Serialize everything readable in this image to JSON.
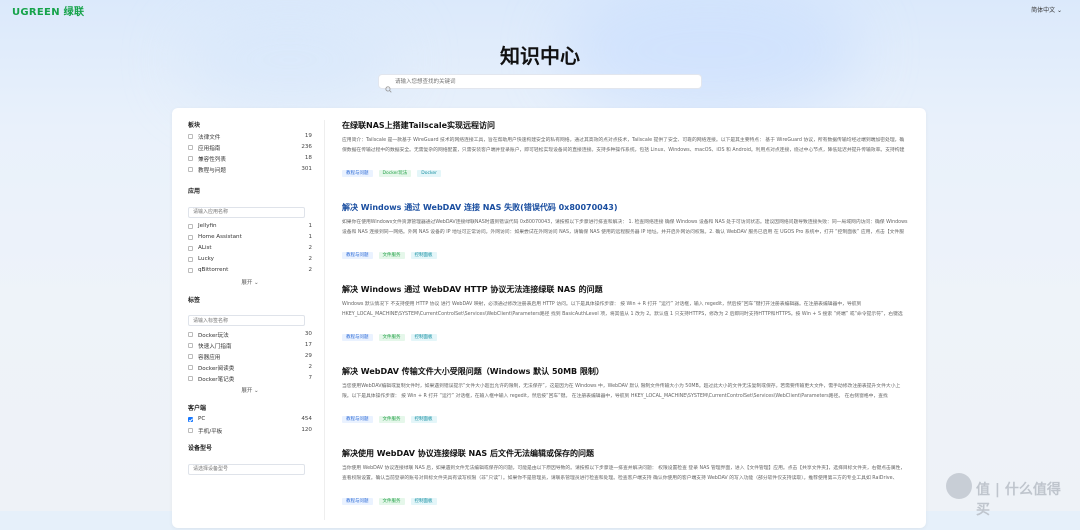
{
  "header": {
    "logo": "UGREEN 绿联",
    "language": "简体中文 ⌄"
  },
  "hero": {
    "title": "知识中心",
    "search_placeholder": "请输入您想查找的关键词"
  },
  "sidebar": {
    "sections": [
      {
        "title": "板块",
        "has_search": false,
        "items": [
          {
            "label": "法律文件",
            "count": "19",
            "checked": false
          },
          {
            "label": "应用指南",
            "count": "236",
            "checked": false
          },
          {
            "label": "兼容性列表",
            "count": "18",
            "checked": false
          },
          {
            "label": "教程与问题",
            "count": "301",
            "checked": false
          }
        ]
      },
      {
        "title": "应用",
        "has_search": true,
        "search_placeholder": "请输入应用名称",
        "items": [
          {
            "label": "Jellyfin",
            "count": "1",
            "checked": false
          },
          {
            "label": "Home Assistant",
            "count": "1",
            "checked": false
          },
          {
            "label": "AList",
            "count": "2",
            "checked": false
          },
          {
            "label": "Lucky",
            "count": "2",
            "checked": false
          },
          {
            "label": "qBittorrent",
            "count": "2",
            "checked": false
          }
        ],
        "expand": "展开 ⌄"
      },
      {
        "title": "标签",
        "has_search": true,
        "search_placeholder": "请输入标签名称",
        "items": [
          {
            "label": "Docker玩法",
            "count": "30",
            "checked": false
          },
          {
            "label": "快速入门指南",
            "count": "17",
            "checked": false
          },
          {
            "label": "容器应用",
            "count": "29",
            "checked": false
          },
          {
            "label": "Docker阅读类",
            "count": "2",
            "checked": false
          },
          {
            "label": "Docker笔记类",
            "count": "7",
            "checked": false
          }
        ],
        "expand": "展开 ⌄"
      },
      {
        "title": "客户端",
        "has_search": false,
        "items": [
          {
            "label": "PC",
            "count": "454",
            "checked": true
          },
          {
            "label": "手机/平板",
            "count": "120",
            "checked": false
          }
        ]
      },
      {
        "title": "设备型号",
        "has_search": true,
        "search_placeholder": "请选择设备型号",
        "items": []
      }
    ]
  },
  "articles": [
    {
      "title": "在绿联NAS上搭建Tailscale实现远程访问",
      "title_color": "dark",
      "excerpt": "应用简介：Tailscale 是一款基于 WireGuard 技术的网络连接工具，旨在帮助用户快速构建安全的私有网络。通过其高效的点对点技术，Tailscale 提供了安全、可靠的网络连接。以下是其主要特点： 基于 WireGuard 协议，所有数据传输均经过端到端加密处理，确保数据在传输过程中的数据安全。无需复杂的网络配置，只需安装客户端并登录账户，即可轻松实现设备间的直接连接。支持多种操作系统，包括 Linux、Windows、macOS、iOS 和 Android。利用点对点连接，绕过中心节点，降低延迟并提升传输效率。支持构建私有云服务，例如文件服务器、游戏服务器等。Tailscale 适用于多种场景，例如当你在外出需要访问家里或公司的电脑。",
      "tags": [
        {
          "text": "教程与问题",
          "kind": "cat"
        },
        {
          "text": "Docker玩法",
          "kind": "app"
        },
        {
          "text": "Docker",
          "kind": "tech"
        }
      ]
    },
    {
      "title": "解决 Windows 通过 WebDAV 连接 NAS 失败(错误代码 0x80070043)",
      "title_color": "blue",
      "excerpt": "如果你在使用Windows文件资源管理器通过WebDAV连接绿联NAS时遇到错误代码 0x80070043，请按照以下步骤进行排查和解决： 1. 检查网络连接 确保 Windows 设备和 NAS 处于可访问状态。建议因网络问题导致连接失败：同一局域网内访问：确保 Windows 设备和 NAS 连接到同一网络。外网 NAS 设备的 IP 地址可正常访问。外网访问：如果尝试在外网访问 NAS，请确保 NAS 使用的远程服务器 IP 地址。并开启外网访问权限。2. 确认 WebDAV 服务已启用 在 UGOS Pro 系统中，打开 “控制面板” 应用，点击【文件服务】 > 【WebDAV】。检查 WebDAV 是否已启用，并确认 HTTP 和 HTTPS 端口号设置正确（默认端口：",
      "tags": [
        {
          "text": "教程与问题",
          "kind": "cat"
        },
        {
          "text": "文件服务",
          "kind": "app"
        },
        {
          "text": "控制面板",
          "kind": "tech"
        }
      ]
    },
    {
      "title": "解决 Windows 通过 WebDAV HTTP 协议无法连接绿联 NAS 的问题",
      "title_color": "dark",
      "excerpt": "Windows 默认情况下 不支持使用 HTTP 协议 进行 WebDAV 映射，必须通过修改注册表启用 HTTP 访问。以下是具体操作步骤： 按 Win + R 打开 “运行” 对话框，输入 regedit，然后按“回车”键打开注册表编辑器。在注册表编辑器中，导航到HKEY_LOCAL_MACHINE\\SYSTEM\\CurrentControlSet\\Services\\WebClient\\Parameters路径 找到 BasicAuthLevel 项，将其值从 1 改为 2。默认值 1 只支持HTTPS，修改为 2 后即同时支持HTTP和HTTPS。按 Win + S 搜索 “终端” 或“命令提示符”，右键选择“以管理员身份运行”。输入以下命令 停止 WebClient 服务： net stop webclient 然后输入以下命令 重新启动 WebClient 服务： net start...",
      "tags": [
        {
          "text": "教程与问题",
          "kind": "cat"
        },
        {
          "text": "文件服务",
          "kind": "app"
        },
        {
          "text": "控制面板",
          "kind": "tech"
        }
      ]
    },
    {
      "title": "解决 WebDAV 传输文件大小受限问题（Windows 默认 50MB 限制）",
      "title_color": "dark",
      "excerpt": "当您使用WebDAV编辑或复制文件时，如果遇到错误提示“文件大小超出允许的限制，无法保存”，这是因为在 Windows 中，WebDAV 默认 限制文件传输大小为 50MB。超过此大小的文件无法复制或保存。若需要传输更大文件，需手动修改注册表提升文件大小上限。以下是具体操作步骤： 按 Win + R 打开 “运行” 对话框，在输入框中输入 regedit，然后按“回车”键。 在注册表编辑器中，导航到 HKEY_LOCAL_MACHINE\\SYSTEM\\CurrentControlSet\\Services\\WebClient\\Parameters路径。 在右侧窗格中，查找 FileSizeLimitInBytes 项。若选项不存在，请在空白处右键点击选择 “新建” > 选择 “DWORD (32...",
      "tags": [
        {
          "text": "教程与问题",
          "kind": "cat"
        },
        {
          "text": "文件服务",
          "kind": "app"
        },
        {
          "text": "控制面板",
          "kind": "tech"
        }
      ]
    },
    {
      "title": "解决使用 WebDAV 协议连接绿联 NAS 后文件无法编辑或保存的问题",
      "title_color": "dark",
      "excerpt": "当你使用 WebDAV 协议连接绿联 NAS 后，如果遇到文件无法编辑或保存的问题，可能是由以下原因导致的。请按照以下步骤逐一排查并解决问题： 权限设置检查 登录 NAS 管理界面，进入【文件管理】应用。点击【共享文件夹】，选择目标文件夹，右键点击属性，查看权限设置。确认当前登录的账号对目标文件夹具有读写权限（非“只读”）。如果你不是管理员，请联系管理员进行检查和处理。检查客户端支持 确认你使用的客户端支持 WebDAV 的写入功能（部分软件仅支持读取）。推荐使用第三方的专业工具如 RaiDrive、Cyberduck。使用 Windows 资源管理器映射网络驱动器时，勾选“登录时重新连接”并选择具有写权限",
      "tags": [
        {
          "text": "教程与问题",
          "kind": "cat"
        },
        {
          "text": "文件服务",
          "kind": "app"
        },
        {
          "text": "控制面板",
          "kind": "tech"
        }
      ]
    }
  ],
  "watermark": {
    "text": "值 | 什么值得买"
  },
  "colors": {
    "brand_green": "#16a34a",
    "link_blue": "#1a4ea0",
    "checkbox_blue": "#1677ff"
  }
}
